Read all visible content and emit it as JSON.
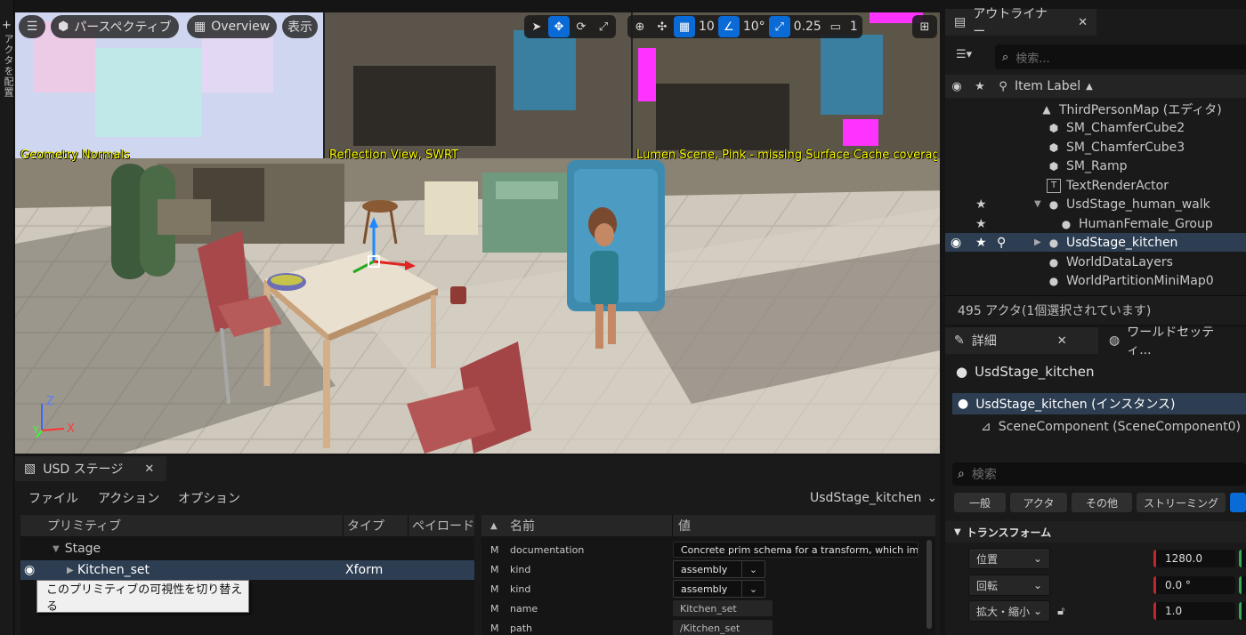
{
  "left_strip": {
    "plus": "+",
    "vertical_label": "アクタを配置"
  },
  "viewport": {
    "menu_icon": "hamburger-icon",
    "perspective_label": "パースペクティブ",
    "overview_label": "Overview",
    "show_label": "表示",
    "grid_snap_value": "10",
    "rotation_snap_value": "10°",
    "scale_snap_value": "0.25",
    "camera_speed_value": "1",
    "view_labels": {
      "geometry": "Geometry Normals",
      "reflection": "Reflection View, SWRT",
      "lumen": "Lumen Scene, Pink - missing Surface Cache coverag"
    },
    "axis": {
      "z": "Z",
      "x": "X",
      "y": "Y"
    },
    "colors": {
      "active": "#0a6bd6",
      "label": "#ffff00"
    }
  },
  "outliner": {
    "tab_label": "アウトライナー",
    "search_placeholder": "検索...",
    "column_label": "Item Label",
    "items": [
      {
        "label": "ThirdPersonMap (エディタ)",
        "icon": "map-icon"
      },
      {
        "label": "SM_ChamferCube2",
        "icon": "cube-icon"
      },
      {
        "label": "SM_ChamferCube3",
        "icon": "cube-icon"
      },
      {
        "label": "SM_Ramp",
        "icon": "cube-icon"
      },
      {
        "label": "TextRenderActor",
        "icon": "text-icon"
      },
      {
        "label": "UsdStage_human_walk",
        "icon": "usd-icon"
      },
      {
        "label": "HumanFemale_Group",
        "icon": "usd-icon"
      },
      {
        "label": "UsdStage_kitchen",
        "icon": "usd-icon"
      },
      {
        "label": "WorldDataLayers",
        "icon": "usd-icon"
      },
      {
        "label": "WorldPartitionMiniMap0",
        "icon": "usd-icon"
      }
    ],
    "footer": "495 アクタ(1個選択されています)",
    "selected_color": "#2d3e52"
  },
  "details": {
    "tab_label": "詳細",
    "world_tab_label": "ワールドセッティ...",
    "actor_name": "UsdStage_kitchen",
    "instance_label": "UsdStage_kitchen (インスタンス)",
    "component_label": "SceneComponent (SceneComponent0)",
    "search_placeholder": "検索",
    "category_buttons": [
      "一般",
      "アクタ",
      "その他",
      "ストリーミング"
    ],
    "section_title": "トランスフォーム",
    "properties": [
      {
        "label": "位置",
        "value": "1280.0"
      },
      {
        "label": "回転",
        "value": "0.0 °"
      },
      {
        "label": "拡大・縮小",
        "value": "1.0"
      }
    ]
  },
  "usd_stage": {
    "tab_label": "USD ステージ",
    "menu": [
      "ファイル",
      "アクション",
      "オプション"
    ],
    "stage_selector": "UsdStage_kitchen",
    "columns": {
      "primitive": "プリミティブ",
      "type": "タイプ",
      "payload": "ペイロード",
      "name": "名前",
      "value": "値"
    },
    "tree": {
      "stage": "Stage",
      "selected_prim": "Kitchen_set",
      "selected_type": "Xform"
    },
    "tooltip": "このプリミティブの可視性を切り替える",
    "attributes": [
      {
        "flag": "M",
        "name": "documentation",
        "value": "Concrete prim schema for a transform, which impl"
      },
      {
        "flag": "M",
        "name": "kind",
        "value": "assembly"
      },
      {
        "flag": "M",
        "name": "kind",
        "value": "assembly"
      },
      {
        "flag": "M",
        "name": "name",
        "value": "Kitchen_set"
      },
      {
        "flag": "M",
        "name": "path",
        "value": "/Kitchen_set"
      }
    ]
  }
}
